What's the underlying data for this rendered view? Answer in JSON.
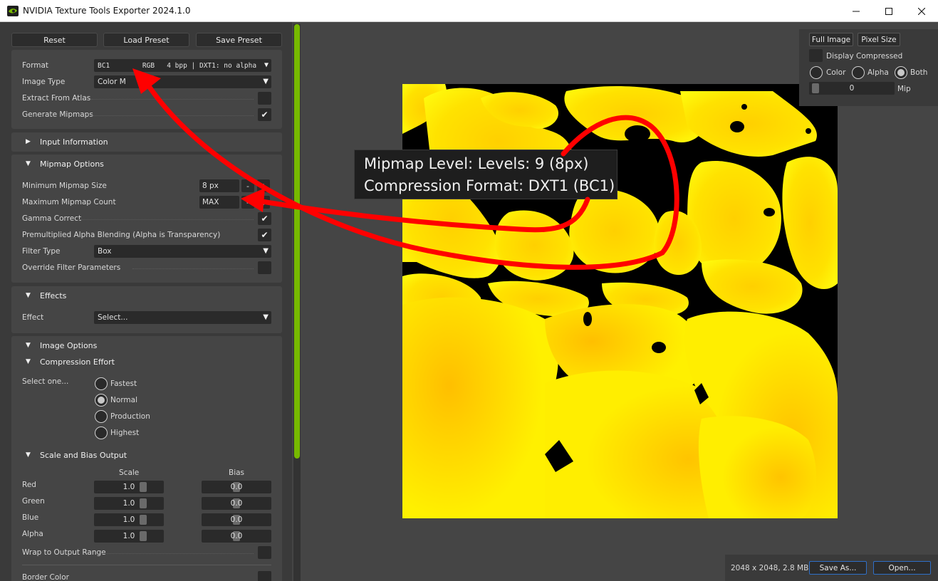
{
  "window": {
    "title": "NVIDIA Texture Tools Exporter 2024.1.0",
    "icon": "nvidia-logo-icon",
    "controls": [
      "minimize-icon",
      "maximize-icon",
      "close-icon"
    ]
  },
  "toolbar": {
    "reset_label": "Reset",
    "load_preset_label": "Load Preset",
    "save_preset_label": "Save Preset"
  },
  "format_section": {
    "format_label": "Format",
    "format_value": "BC1        RGB   4 bpp | DXT1: no alpha",
    "image_type_label": "Image Type",
    "image_type_value": "Color M",
    "extract_atlas_label": "Extract From Atlas",
    "extract_atlas_checked": false,
    "generate_mipmaps_label": "Generate Mipmaps",
    "generate_mipmaps_checked": true
  },
  "input_info": {
    "title": "Input Information",
    "expanded": false
  },
  "mipmap_options": {
    "title": "Mipmap Options",
    "min_size_label": "Minimum Mipmap Size",
    "min_size_value": "8 px",
    "max_count_label": "Maximum Mipmap Count",
    "max_count_value": "MAX",
    "minus_label": "-",
    "plus_label": "+",
    "gamma_label": "Gamma Correct",
    "gamma_checked": true,
    "premult_label": "Premultiplied Alpha Blending (Alpha is Transparency)",
    "premult_checked": true,
    "filter_type_label": "Filter Type",
    "filter_type_value": "Box",
    "override_label": "Override Filter Parameters",
    "override_checked": false
  },
  "effects": {
    "title": "Effects",
    "effect_label": "Effect",
    "effect_value": "Select..."
  },
  "image_options": {
    "title": "Image Options",
    "compression_effort_title": "Compression Effort",
    "select_one_label": "Select one...",
    "effort_options": [
      "Fastest",
      "Normal",
      "Production",
      "Highest"
    ],
    "effort_selected": "Normal",
    "scale_bias_title": "Scale and Bias Output",
    "scale_header": "Scale",
    "bias_header": "Bias",
    "channels": [
      {
        "name": "Red",
        "scale": "1.0",
        "bias": "0.0"
      },
      {
        "name": "Green",
        "scale": "1.0",
        "bias": "0.0"
      },
      {
        "name": "Blue",
        "scale": "1.0",
        "bias": "0.0"
      },
      {
        "name": "Alpha",
        "scale": "1.0",
        "bias": "0.0"
      }
    ],
    "wrap_label": "Wrap to Output Range",
    "wrap_checked": false,
    "border_color_label": "Border Color"
  },
  "viewer": {
    "full_image_label": "Full Image",
    "pixel_size_label": "Pixel Size",
    "display_compressed_label": "Display Compressed",
    "display_compressed_checked": false,
    "channel_options": [
      "Color",
      "Alpha",
      "Both"
    ],
    "channel_selected": "Both",
    "mip_value": "0",
    "mip_label": "Mip",
    "tooltip_line1": "Mipmap Level: Levels: 9 (8px)",
    "tooltip_line2": "Compression Format: DXT1 (BC1)",
    "image_info": "2048 x 2048, 2.8 MB",
    "save_as_label": "Save As...",
    "open_label": "Open...",
    "accent_color": "#76b900",
    "annotation_color": "#ff0000"
  }
}
